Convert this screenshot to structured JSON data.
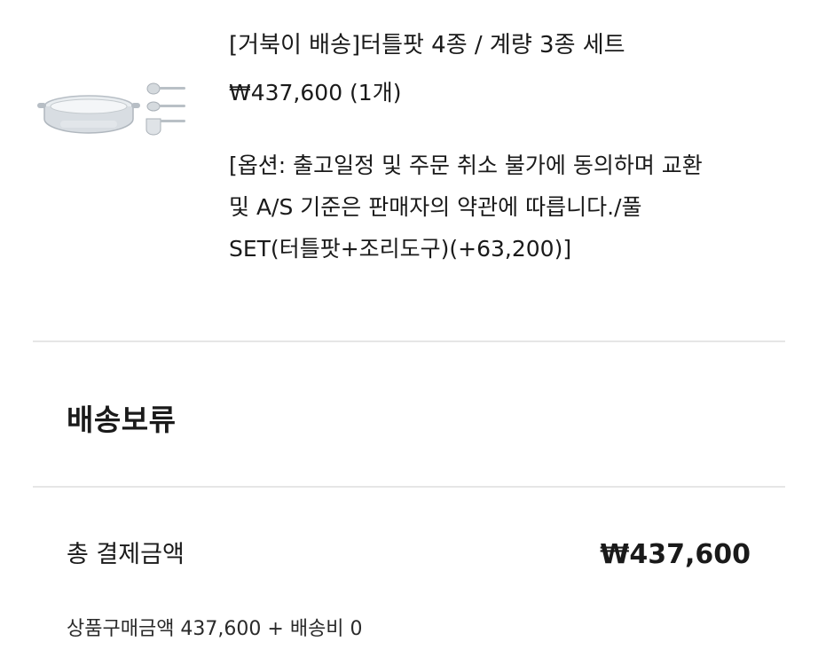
{
  "product": {
    "image_alt": "터틀팟 4종 / 계량 3종 세트 product image",
    "title": "[거북이 배송]터틀팟 4종 / 계량 3종 세트",
    "price_line": "₩437,600 (1개)",
    "option_text": "[옵션: 출고일정 및 주문 취소 불가에 동의하며 교환 및 A/S 기준은 판매자의 약관에 따릅니다./풀 SET(터틀팟+조리도구)(+63,200)]"
  },
  "order_status": "배송보류",
  "payment": {
    "total_label": "총 결제금액",
    "total_amount": "₩437,600",
    "breakdown": "상품구매금액 437,600 + 배송비 0"
  },
  "colors": {
    "text": "#1a1a1a",
    "divider": "#e6e6e6",
    "background": "#ffffff"
  }
}
